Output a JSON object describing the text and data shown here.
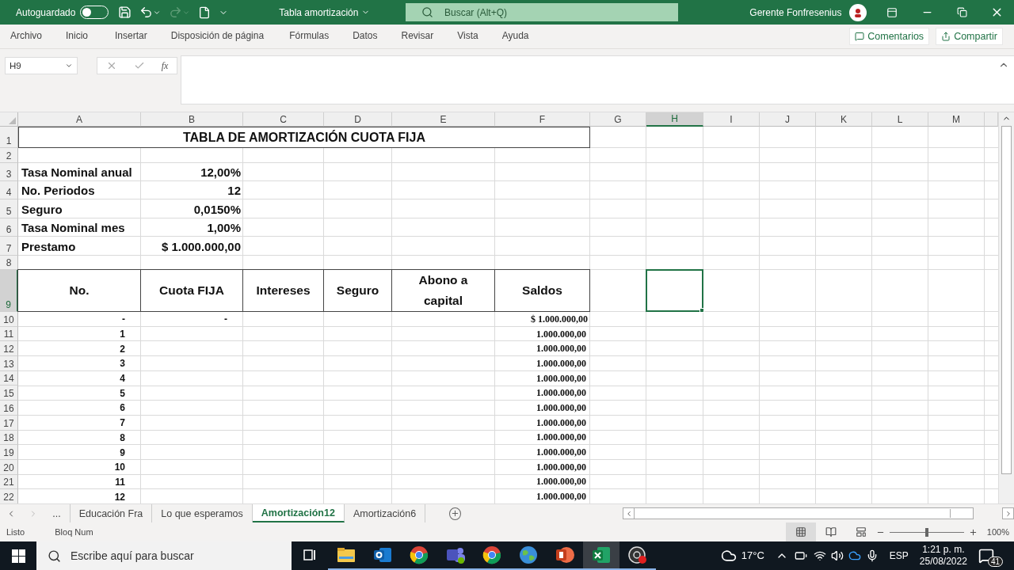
{
  "window": {
    "autosave": {
      "label": "Autoguardado",
      "on": false
    },
    "title": "Tabla amortización",
    "search": {
      "placeholder": "Buscar (Alt+Q)"
    },
    "user": "Gerente Fonfresenius"
  },
  "ribbon_tabs": [
    {
      "label": "Archivo",
      "selected": false
    },
    {
      "label": "Inicio",
      "selected": false
    },
    {
      "label": "Insertar",
      "selected": false
    },
    {
      "label": "Disposición de página",
      "selected": false
    },
    {
      "label": "Fórmulas",
      "selected": false
    },
    {
      "label": "Datos",
      "selected": false
    },
    {
      "label": "Revisar",
      "selected": false
    },
    {
      "label": "Vista",
      "selected": false
    },
    {
      "label": "Ayuda",
      "selected": false
    }
  ],
  "ribbon_buttons": [
    "Comentarios",
    "Compartir"
  ],
  "name_box": "H9",
  "function_label": "fx",
  "columns": [
    {
      "label": "A",
      "selected": false
    },
    {
      "label": "B",
      "selected": false
    },
    {
      "label": "C",
      "selected": false
    },
    {
      "label": "D",
      "selected": false
    },
    {
      "label": "E",
      "selected": false
    },
    {
      "label": "F",
      "selected": false
    },
    {
      "label": "G",
      "selected": false
    },
    {
      "label": "H",
      "selected": true
    },
    {
      "label": "I",
      "selected": false
    },
    {
      "label": "J",
      "selected": false
    },
    {
      "label": "K",
      "selected": false
    },
    {
      "label": "L",
      "selected": false
    },
    {
      "label": "M",
      "selected": false
    }
  ],
  "row_headers": [
    {
      "label": "1",
      "selected": false
    },
    {
      "label": "2",
      "selected": false
    },
    {
      "label": "3",
      "selected": false
    },
    {
      "label": "4",
      "selected": false
    },
    {
      "label": "5",
      "selected": false
    },
    {
      "label": "6",
      "selected": false
    },
    {
      "label": "7",
      "selected": false
    },
    {
      "label": "8",
      "selected": false
    },
    {
      "label": "9",
      "selected": true
    },
    {
      "label": "10",
      "selected": false
    },
    {
      "label": "11",
      "selected": false
    },
    {
      "label": "12",
      "selected": false
    },
    {
      "label": "13",
      "selected": false
    },
    {
      "label": "14",
      "selected": false
    },
    {
      "label": "15",
      "selected": false
    },
    {
      "label": "16",
      "selected": false
    },
    {
      "label": "17",
      "selected": false
    },
    {
      "label": "18",
      "selected": false
    },
    {
      "label": "19",
      "selected": false
    },
    {
      "label": "20",
      "selected": false
    },
    {
      "label": "21",
      "selected": false
    },
    {
      "label": "22",
      "selected": false
    }
  ],
  "sheet": {
    "title": "TABLA DE AMORTIZACIÓN CUOTA FIJA",
    "parameters": [
      {
        "label": "Tasa Nominal anual",
        "value": "12,00%"
      },
      {
        "label": "No. Periodos",
        "value": "12"
      },
      {
        "label": "Seguro",
        "value": "0,0150%"
      },
      {
        "label": "Tasa Nominal mes",
        "value": "1,00%"
      },
      {
        "label": "Prestamo",
        "value": "$ 1.000.000,00"
      }
    ],
    "headers": [
      "No.",
      "Cuota FIJA",
      "Intereses",
      "Seguro",
      "Abono a capital",
      "Saldos"
    ],
    "rows": [
      {
        "no": "-",
        "cuota": "-",
        "saldo": "$ 1.000.000,00"
      },
      {
        "no": "1",
        "saldo": "1.000.000,00"
      },
      {
        "no": "2",
        "saldo": "1.000.000,00"
      },
      {
        "no": "3",
        "saldo": "1.000.000,00"
      },
      {
        "no": "4",
        "saldo": "1.000.000,00"
      },
      {
        "no": "5",
        "saldo": "1.000.000,00"
      },
      {
        "no": "6",
        "saldo": "1.000.000,00"
      },
      {
        "no": "7",
        "saldo": "1.000.000,00"
      },
      {
        "no": "8",
        "saldo": "1.000.000,00"
      },
      {
        "no": "9",
        "saldo": "1.000.000,00"
      },
      {
        "no": "10",
        "saldo": "1.000.000,00"
      },
      {
        "no": "11",
        "saldo": "1.000.000,00"
      },
      {
        "no": "12",
        "saldo": "1.000.000,00"
      }
    ]
  },
  "sheet_tabs": {
    "overflow": "...",
    "tabs": [
      {
        "label": "Educación Fra",
        "selected": false
      },
      {
        "label": "Lo que esperamos",
        "selected": false
      },
      {
        "label": "Amortización12",
        "selected": true
      },
      {
        "label": "Amortización6",
        "selected": false
      }
    ]
  },
  "status_bar": {
    "mode": "Listo",
    "num_lock": "Bloq Num",
    "zoom": {
      "level": 0.5,
      "reading": "100%"
    }
  },
  "taskbar": {
    "search": {
      "placeholder": "Escribe aquí para buscar"
    },
    "weather": "17°C",
    "language": "ESP",
    "time": "1:21 p. m.",
    "date": "25/08/2022",
    "notifications": "41"
  }
}
